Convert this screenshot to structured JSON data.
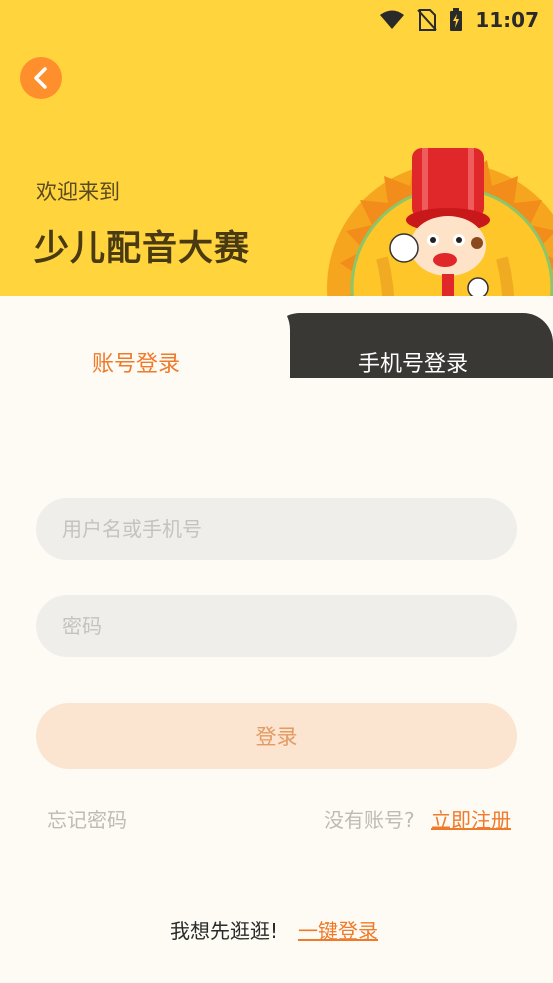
{
  "status_bar": {
    "time": "11:07"
  },
  "header": {
    "welcome": "欢迎来到",
    "title": "少儿配音大赛"
  },
  "tabs": {
    "account_login": "账号登录",
    "phone_login": "手机号登录"
  },
  "form": {
    "username_placeholder": "用户名或手机号",
    "password_placeholder": "密码",
    "login_label": "登录"
  },
  "links": {
    "forgot_password": "忘记密码",
    "no_account": "没有账号?",
    "register_now": "立即注册",
    "browse_first": "我想先逛逛!",
    "one_click_login": "一键登录"
  },
  "colors": {
    "header_bg": "#FFD43C",
    "accent": "#F07A2A",
    "inactive_tab": "#3A3835",
    "login_button_bg": "#FBE4D0"
  }
}
